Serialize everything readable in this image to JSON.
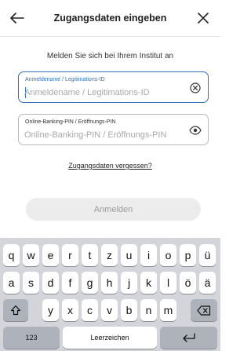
{
  "header": {
    "title": "Zugangsdaten eingeben",
    "back_icon": "arrow-left-icon",
    "close_icon": "close-icon"
  },
  "login": {
    "subtitle": "Melden Sie sich bei Ihrem Institut an",
    "username": {
      "label": "Anmeldename / Legitimations-ID",
      "placeholder": "Anmeldename / Legitimations-ID",
      "value": "",
      "icon": "clear-circle-icon"
    },
    "pin": {
      "label": "Online-Banking-PIN / Eröffnungs-PIN",
      "placeholder": "Online-Banking-PIN / Eröffnungs-PIN",
      "value": "",
      "icon": "eye-icon"
    },
    "forgot_link": "Zugangsdaten vergessen?",
    "submit_label": "Anmelden"
  },
  "colors": {
    "accent": "#2d72c2",
    "button_disabled_bg": "#ececec",
    "button_disabled_text": "#9a9a9a",
    "keyboard_bg": "#d3d5da"
  },
  "keyboard": {
    "row1": [
      "q",
      "w",
      "e",
      "r",
      "t",
      "z",
      "u",
      "i",
      "o",
      "p",
      "ü"
    ],
    "row2": [
      "a",
      "s",
      "d",
      "f",
      "g",
      "h",
      "j",
      "k",
      "l",
      "ö",
      "ä"
    ],
    "row3": [
      "y",
      "x",
      "c",
      "v",
      "b",
      "n",
      "m"
    ],
    "shift_icon": "shift-icon",
    "backspace_icon": "backspace-icon",
    "numbers_label": "123",
    "space_label": "Leerzeichen",
    "return_icon": "return-icon"
  }
}
